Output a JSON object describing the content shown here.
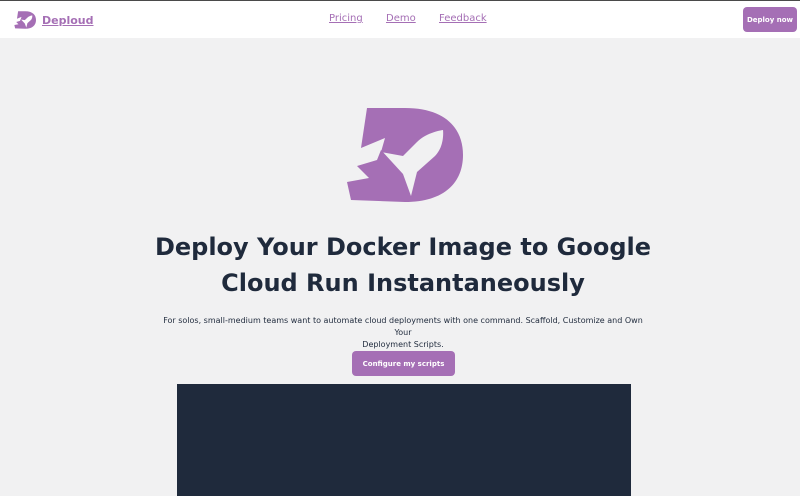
{
  "nav": {
    "brand": "Deploud",
    "links": [
      "Pricing",
      "Demo",
      "Feedback"
    ],
    "cta": "Deploy now"
  },
  "hero": {
    "logo_icon": "rocket-d-logo-icon",
    "title_line1": "Deploy Your Docker Image to Google",
    "title_line2": "Cloud Run Instantaneously",
    "subtitle_line1": "For solos, small-medium teams want to automate cloud deployments with one command. Scaffold, Customize and Own Your",
    "subtitle_line2": "Deployment Scripts.",
    "cta": "Configure my scripts"
  },
  "colors": {
    "brand": "#a56fb5",
    "text": "#1f2a3c",
    "background": "#f1f1f2",
    "panel": "#1f2a3c"
  }
}
